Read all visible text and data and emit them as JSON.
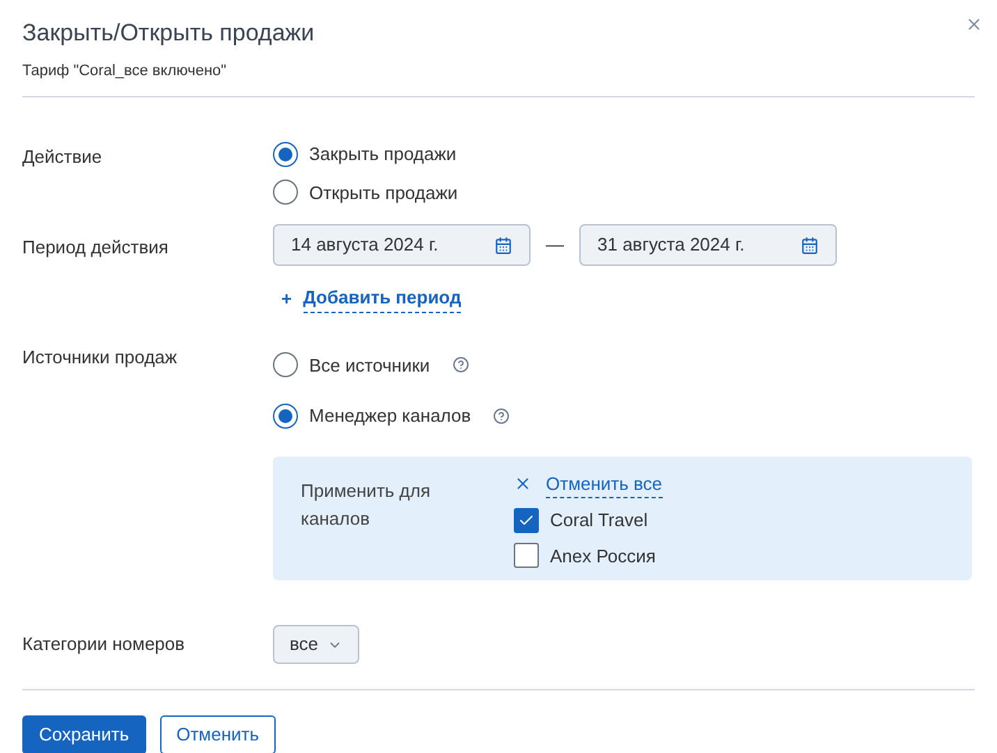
{
  "dialog": {
    "title": "Закрыть/Открыть продажи",
    "subtitle": "Тариф \"Coral_все включено\""
  },
  "action": {
    "label": "Действие",
    "options": [
      {
        "label": "Закрыть продажи",
        "selected": true
      },
      {
        "label": "Открыть продажи",
        "selected": false
      }
    ]
  },
  "period": {
    "label": "Период действия",
    "from": "14 августа 2024 г.",
    "separator": "—",
    "to": "31 августа 2024 г.",
    "add_link": {
      "icon": "+",
      "label": "Добавить период"
    }
  },
  "sources": {
    "label": "Источники продаж",
    "options": [
      {
        "label": "Все источники",
        "selected": false
      },
      {
        "label": "Менеджер каналов",
        "selected": true
      }
    ],
    "channels_panel": {
      "label": "Применить для каналов",
      "clear_link": "Отменить все",
      "channels": [
        {
          "label": "Coral Travel",
          "checked": true
        },
        {
          "label": "Anex Россия",
          "checked": false
        }
      ]
    }
  },
  "room_categories": {
    "label": "Категории номеров",
    "value": "все"
  },
  "buttons": [
    {
      "label": "Сохранить",
      "kind": "primary"
    },
    {
      "label": "Отменить",
      "kind": "secondary"
    }
  ]
}
